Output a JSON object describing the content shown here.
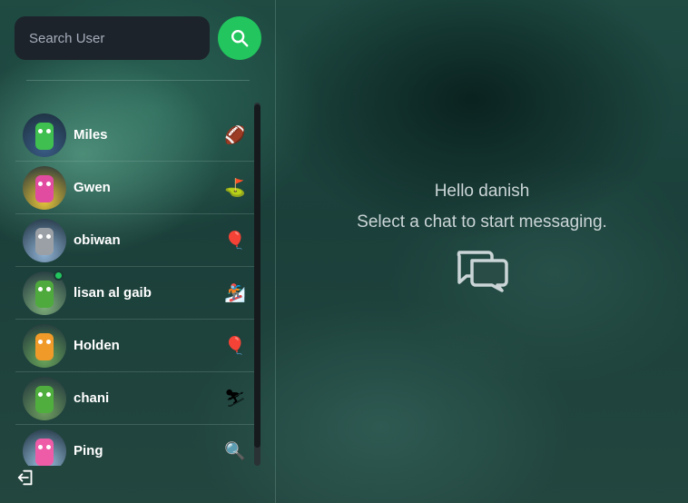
{
  "search": {
    "placeholder": "Search User"
  },
  "users": [
    {
      "name": "Miles",
      "emoji": "🏈",
      "avatar_bg": "#3a5c86",
      "bot_color": "#3fbf4f",
      "online": false
    },
    {
      "name": "Gwen",
      "emoji": "⛳",
      "avatar_bg": "#e8c53a",
      "bot_color": "#e14ca0",
      "online": false
    },
    {
      "name": "obiwan",
      "emoji": "🎈",
      "avatar_bg": "#8fb2d4",
      "bot_color": "#9aa0a6",
      "online": false
    },
    {
      "name": "lisan al gaib",
      "emoji": "🏂",
      "avatar_bg": "#7fb07a",
      "bot_color": "#4faa3e",
      "online": true
    },
    {
      "name": "Holden",
      "emoji": "🎈",
      "avatar_bg": "#6aa65a",
      "bot_color": "#f09a2a",
      "online": false
    },
    {
      "name": "chani",
      "emoji": "⛷",
      "avatar_bg": "#6f9e5f",
      "bot_color": "#4fae3e",
      "online": false
    },
    {
      "name": "Ping",
      "emoji": "🔍",
      "avatar_bg": "#9cc3e2",
      "bot_color": "#ee5ca8",
      "online": false
    }
  ],
  "welcome": {
    "greeting": "Hello danish",
    "message": "Select a chat to start messaging."
  },
  "icons": {
    "search": "search-icon",
    "logout": "logout-icon",
    "chat": "chat-bubbles-icon"
  },
  "colors": {
    "accent": "#22c55e",
    "input_bg": "#1d232a",
    "text_muted": "#cbd5d8"
  }
}
